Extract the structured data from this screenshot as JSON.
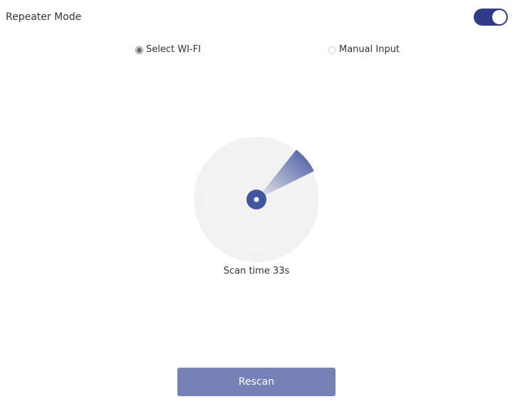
{
  "header": {
    "title": "Repeater Mode",
    "toggle_on": true
  },
  "mode_options": [
    {
      "label": "Select WI-FI",
      "selected": true
    },
    {
      "label": "Manual Input",
      "selected": false
    }
  ],
  "scan": {
    "status_text": "Scan time 33s"
  },
  "actions": {
    "rescan_label": "Rescan"
  },
  "colors": {
    "accent": "#2f3b86",
    "button": "#7682b7",
    "radar_bg": "#f2f2f2",
    "radar_center": "#4356a0"
  }
}
